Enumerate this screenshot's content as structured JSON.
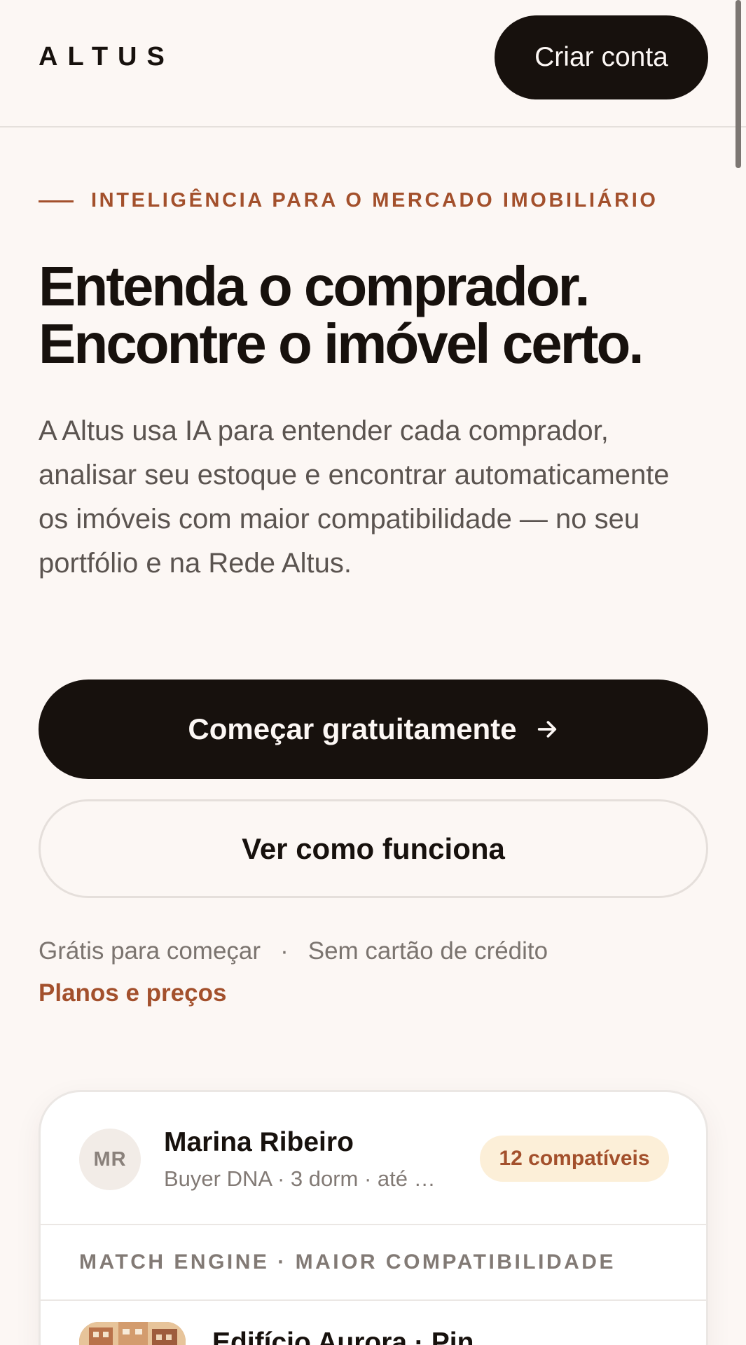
{
  "header": {
    "logo": "ALTUS",
    "create_account_label": "Criar conta"
  },
  "hero": {
    "eyebrow": "INTELIGÊNCIA PARA O MERCADO IMOBILIÁRIO",
    "headline_line1": "Entenda o comprador.",
    "headline_line2": "Encontre o imóvel certo.",
    "lead": "A Altus usa IA para entender cada comprador, analisar seu estoque e encontrar automaticamente os imóveis com maior compatibilidade — no seu portfólio e na Rede Altus.",
    "primary_cta": "Começar gratuitamente",
    "secondary_cta": "Ver como funciona",
    "meta_free": "Grátis para começar",
    "meta_separator": "·",
    "meta_card": "Sem cartão de crédito",
    "pricing_link": "Planos e preços"
  },
  "card": {
    "avatar_initials": "MR",
    "buyer_name": "Marina Ribeiro",
    "buyer_sub": "Buyer DNA · 3 dorm · até R…",
    "badge": "12 compatíveis",
    "engine_label": "MATCH ENGINE · MAIOR COMPATIBILIDADE",
    "property_title": "Edifício Aurora · Pin"
  },
  "colors": {
    "background": "#fcf7f4",
    "ink": "#17110d",
    "accent": "#a3502c",
    "badge_bg": "#fcefd8"
  },
  "icons": {
    "cta_arrow": "arrow-right-icon"
  }
}
